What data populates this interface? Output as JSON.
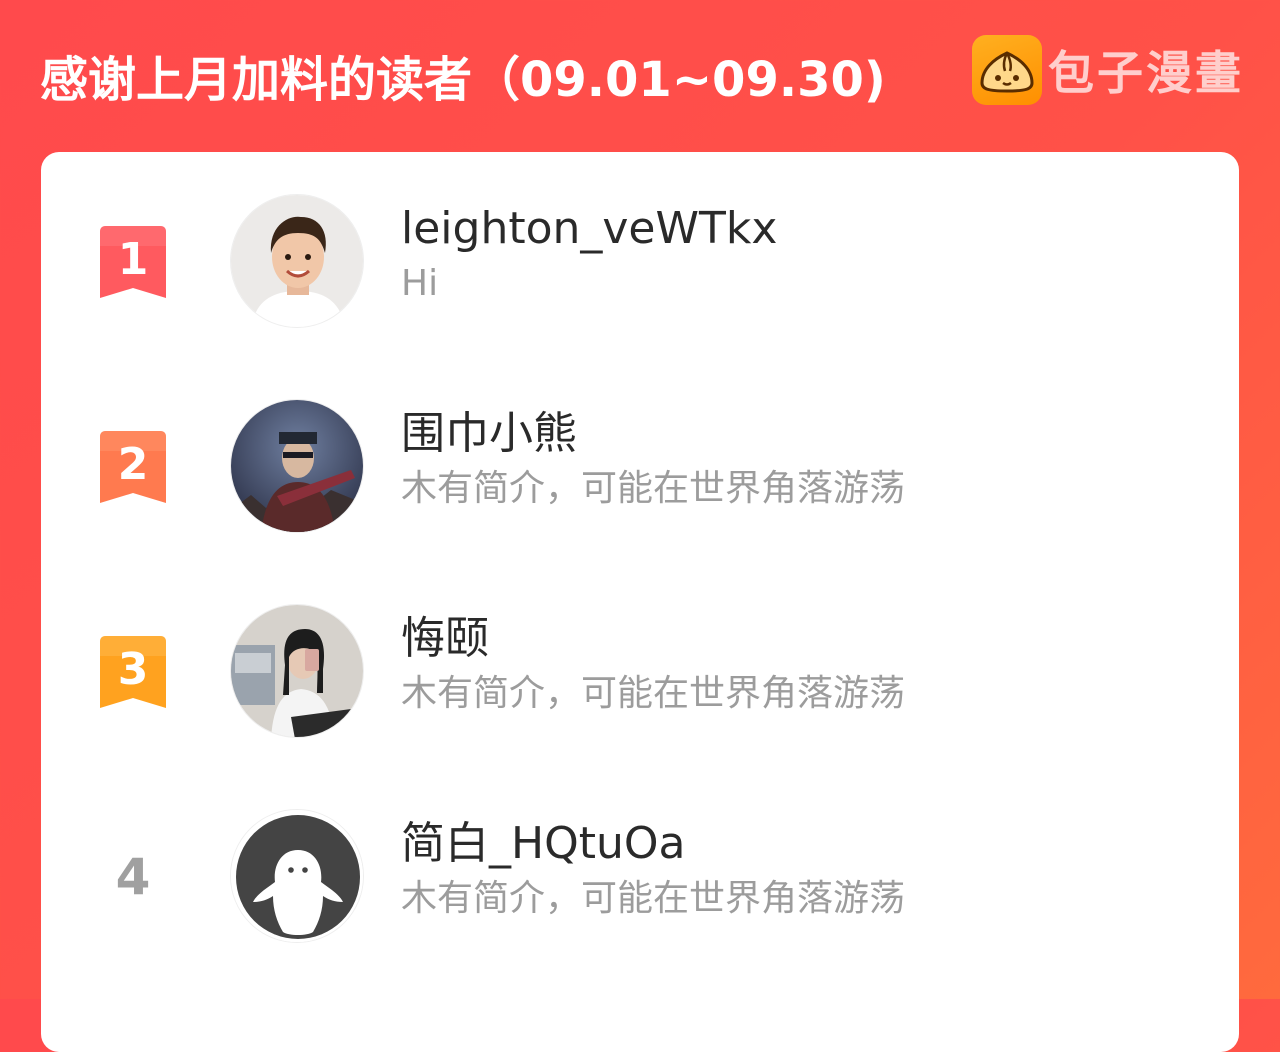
{
  "header": {
    "title": "感谢上月加料的读者（09.01~09.30)",
    "brand_name": "包子漫畫",
    "brand_logo_icon": "baozi-bun-icon"
  },
  "colors": {
    "background": "#ff4a4c",
    "rank_1": "#ff5a5f",
    "rank_2": "#ff7a4f",
    "rank_3": "#ffa21f",
    "rank_plain": "#a0a0a0"
  },
  "readers": [
    {
      "rank": "1",
      "name": "leighton_veWTkx",
      "desc": "Hi",
      "avatar": "photo-avatar-boy"
    },
    {
      "rank": "2",
      "name": "围巾小熊",
      "desc": "木有简介，可能在世界角落游荡",
      "avatar": "game-character-avatar"
    },
    {
      "rank": "3",
      "name": "悔颐",
      "desc": "木有简介，可能在世界角落游荡",
      "avatar": "photo-avatar-girl"
    },
    {
      "rank": "4",
      "name": "简白_HQtuOa",
      "desc": "木有简介，可能在世界角落游荡",
      "avatar": "default-avatar-icon"
    }
  ]
}
